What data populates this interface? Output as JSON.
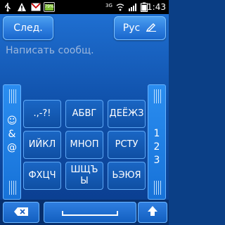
{
  "status_bar": {
    "battery_percent": "79%",
    "network": "3G",
    "time": "1:43",
    "icons": [
      "usb-icon",
      "warning-icon",
      "gmail-icon",
      "battery-icon",
      "wifi-icon",
      "signal-icon",
      "battery-status-icon"
    ]
  },
  "toolbar": {
    "next_label": "След.",
    "lang_label": "Рус"
  },
  "compose": {
    "placeholder": "Написать сообщ."
  },
  "keyboard": {
    "left_symbols": [
      "☺",
      "&",
      "@"
    ],
    "right_digits": [
      "1",
      "2",
      "3"
    ],
    "keys": [
      ".,-?!",
      "АБВГ",
      "ДЕЁЖЗ",
      "ИЙКЛ",
      "МНОП",
      "РСТУ",
      "ФХЦЧ",
      "ШЩЪ\nЫ",
      "ЬЭЮЯ"
    ]
  },
  "colors": {
    "accent": "#2f7fe0",
    "background": "#0b3f86"
  }
}
